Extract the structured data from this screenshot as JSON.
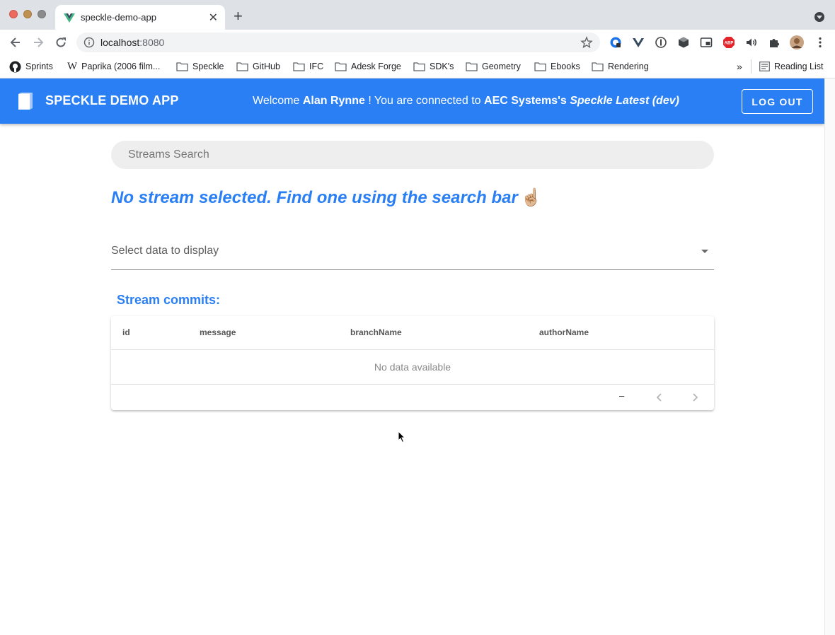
{
  "browser": {
    "tab_title": "speckle-demo-app",
    "url_host": "localhost",
    "url_port": ":8080",
    "bookmarks": [
      "Sprints",
      "Paprika (2006 film...",
      "Speckle",
      "GitHub",
      "IFC",
      "Adesk Forge",
      "SDK's",
      "Geometry",
      "Ebooks",
      "Rendering"
    ],
    "bookmarks_more": "»",
    "reading_list": "Reading List"
  },
  "appbar": {
    "title": "SPECKLE DEMO APP",
    "welcome_prefix": "Welcome",
    "user_name": "Alan Rynne",
    "connected_text": "! You are connected to",
    "server_owner": "AEC Systems's",
    "server_name": "Speckle Latest (dev)",
    "logout_label": "LOG OUT",
    "color": "#2a7ff4"
  },
  "search": {
    "placeholder": "Streams Search"
  },
  "main": {
    "headline": "No stream selected. Find one using the search bar",
    "headline_emoji": "☝🏼",
    "select_label": "Select data to display",
    "commits_title": "Stream commits:"
  },
  "table": {
    "columns": [
      "id",
      "message",
      "branchName",
      "authorName"
    ],
    "empty_text": "No data available",
    "pagination_text": "–"
  }
}
